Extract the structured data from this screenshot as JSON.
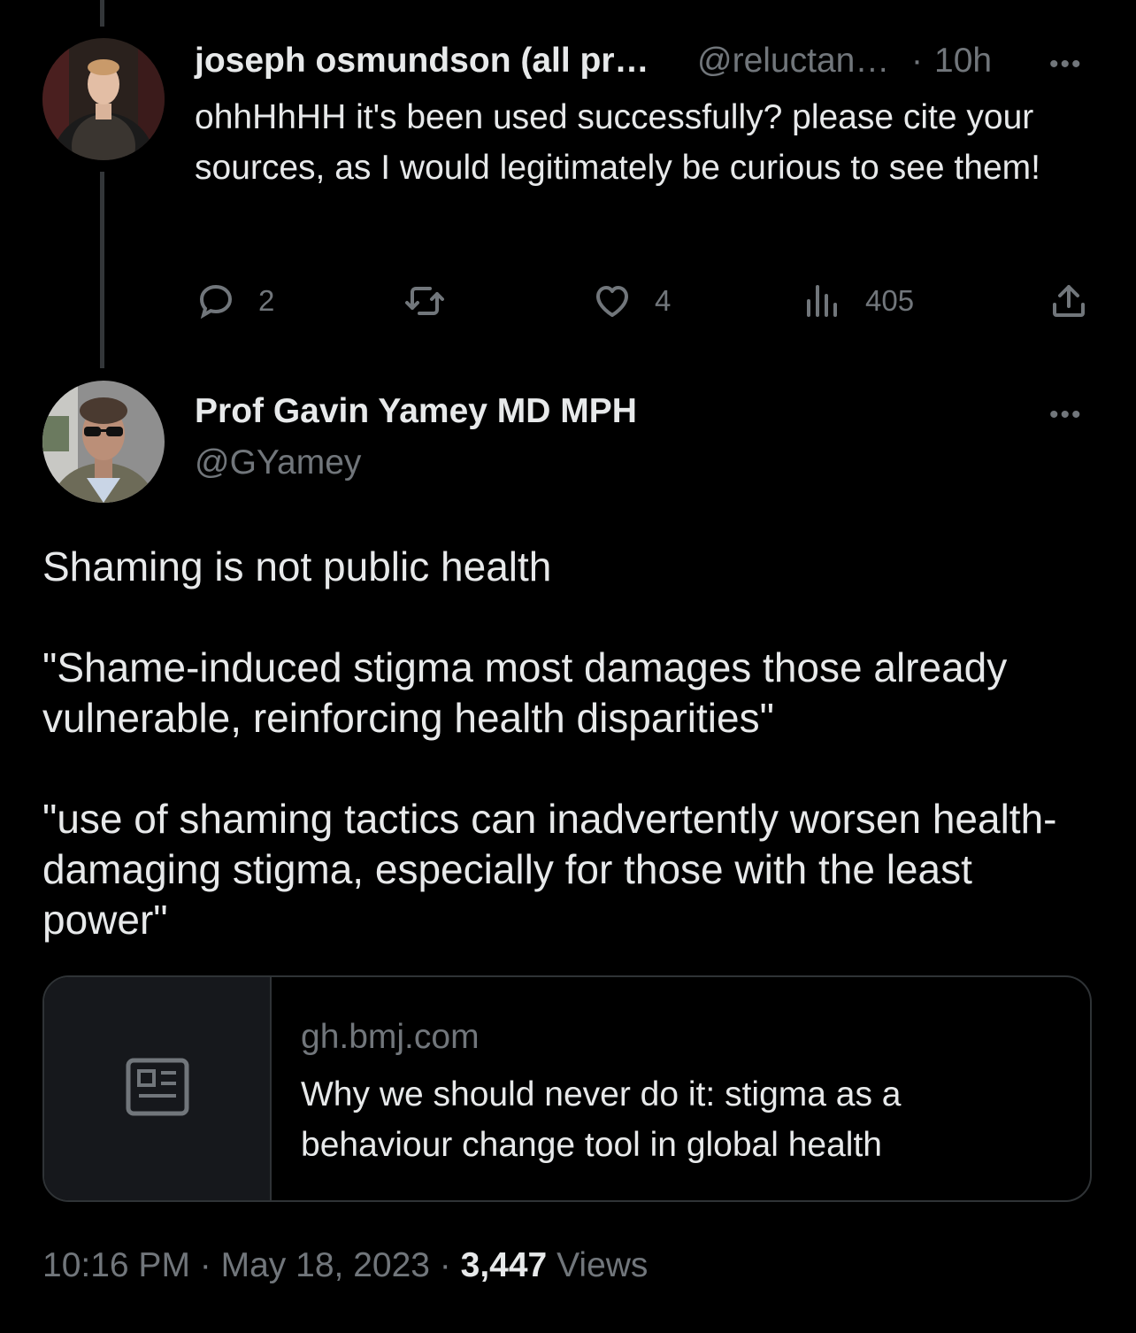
{
  "parent_tweet": {
    "display_name": "joseph osmundson (all pr…",
    "handle": "@reluctan…",
    "separator": "·",
    "time": "10h",
    "more": "•••",
    "text": "ohhHhHH it's been used successfully? please cite your sources, as I would legitimately be curious to see them!",
    "replies": "2",
    "retweets": "",
    "likes": "4",
    "views": "405"
  },
  "main_tweet": {
    "display_name": "Prof Gavin Yamey MD MPH",
    "handle": "@GYamey",
    "more": "•••",
    "paragraphs": [
      "Shaming is not public health",
      "\"Shame-induced stigma most damages those already vulnerable, reinforcing health disparities\"",
      "\"use of shaming tactics can inadvertently worsen health-damaging stigma, especially for those with the least power\""
    ],
    "link_card": {
      "domain": "gh.bmj.com",
      "title": "Why we should never do it: stigma as a behaviour change tool in global health",
      "icon": "article-icon"
    },
    "timestamp_time": "10:16 PM",
    "separator": "·",
    "timestamp_date": "May 18, 2023",
    "views_count": "3,447",
    "views_label": "Views"
  },
  "icons": {
    "reply": "reply-icon",
    "retweet": "retweet-icon",
    "like": "heart-icon",
    "views": "analytics-icon",
    "share": "share-icon"
  },
  "colors": {
    "background": "#000000",
    "text": "#e7e9ea",
    "muted": "#71767b",
    "border": "#2f3336"
  }
}
